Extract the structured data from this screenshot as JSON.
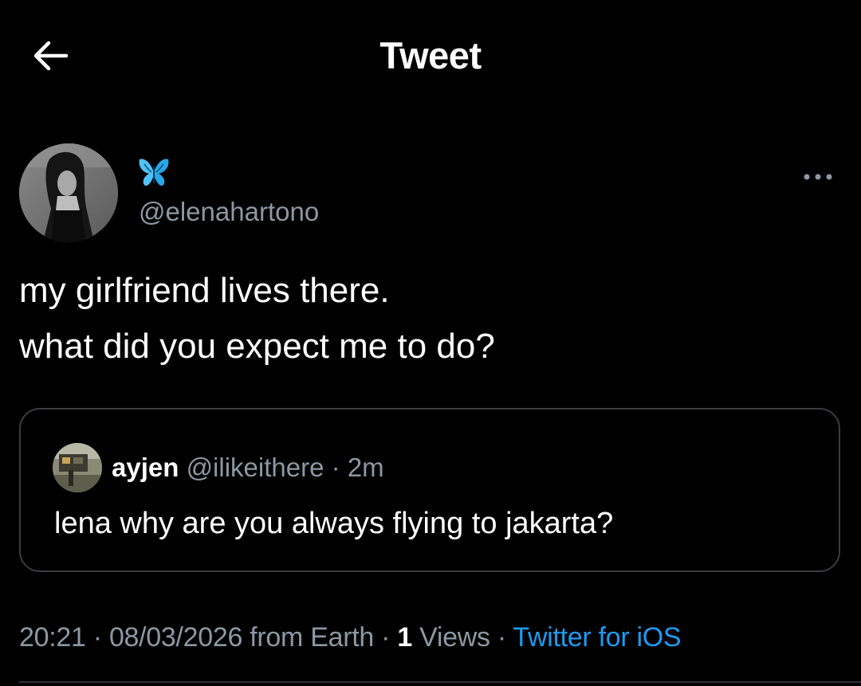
{
  "header": {
    "title": "Tweet",
    "back_icon": "arrow-left-icon"
  },
  "tweet": {
    "display_name_icon": "butterfly-emoji",
    "handle": "@elenahartono",
    "more_icon": "more-horizontal-icon",
    "text_lines": [
      "my girlfriend lives there.",
      "what did you expect me to do?"
    ]
  },
  "quote": {
    "name": "ayjen",
    "handle": "@ilikeithere",
    "separator": "·",
    "time": "2m",
    "text": "lena why are you always flying to jakarta?"
  },
  "meta": {
    "time": "20:21",
    "date": "08/03/2026",
    "location": "from Earth",
    "views_count": "1",
    "views_label": "Views",
    "source": "Twitter for iOS",
    "separator": "·"
  },
  "colors": {
    "background": "#000000",
    "text_primary": "#ffffff",
    "text_secondary": "#8b98a5",
    "accent": "#1d9bf0",
    "border": "#3a3d41"
  }
}
